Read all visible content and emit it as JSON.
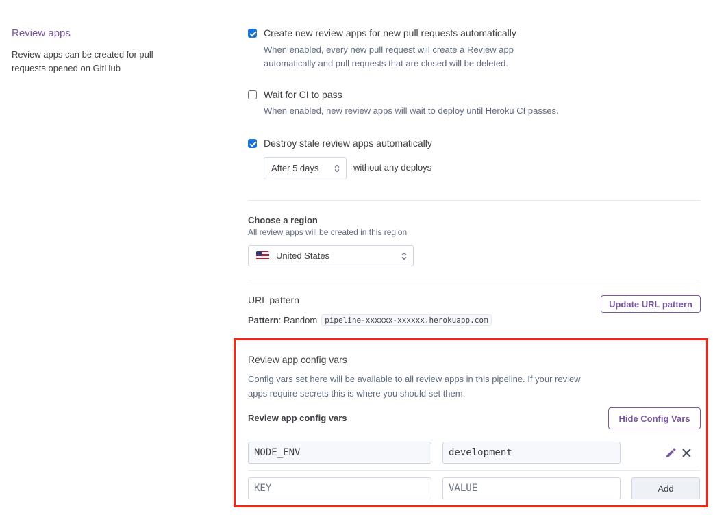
{
  "section": {
    "title": "Review apps",
    "description": "Review apps can be created for pull requests opened on GitHub"
  },
  "options": {
    "auto_create": {
      "checked": true,
      "label": "Create new review apps for new pull requests automatically",
      "help_line1": "When enabled, every new pull request will create a Review app",
      "help_line2": "automatically and pull requests that are closed will be deleted."
    },
    "wait_ci": {
      "checked": false,
      "label": "Wait for CI to pass",
      "help": "When enabled, new review apps will wait to deploy until Heroku CI passes."
    },
    "destroy_stale": {
      "checked": true,
      "label": "Destroy stale review apps automatically",
      "selected": "After 5 days",
      "suffix": "without any deploys"
    }
  },
  "region": {
    "title": "Choose a region",
    "help": "All review apps will be created in this region",
    "selected": "United States",
    "flag_icon": "us-flag-icon"
  },
  "url_pattern": {
    "title": "URL pattern",
    "label": "Pattern",
    "mode": "Random",
    "example": "pipeline-xxxxxx-xxxxxx.herokuapp.com",
    "button": "Update URL pattern"
  },
  "config_vars": {
    "title": "Review app config vars",
    "desc_line1": "Config vars set here will be available to all review apps in this pipeline. If your review",
    "desc_line2": "apps require secrets this is where you should set them.",
    "subtitle": "Review app config vars",
    "toggle_button": "Hide Config Vars",
    "vars": [
      {
        "key": "NODE_ENV",
        "value": "development"
      }
    ],
    "new_key_placeholder": "KEY",
    "new_value_placeholder": "VALUE",
    "add_button": "Add"
  },
  "colors": {
    "accent": "#79589f",
    "checkbox": "#1a73d9",
    "highlight": "#ed2a17"
  }
}
